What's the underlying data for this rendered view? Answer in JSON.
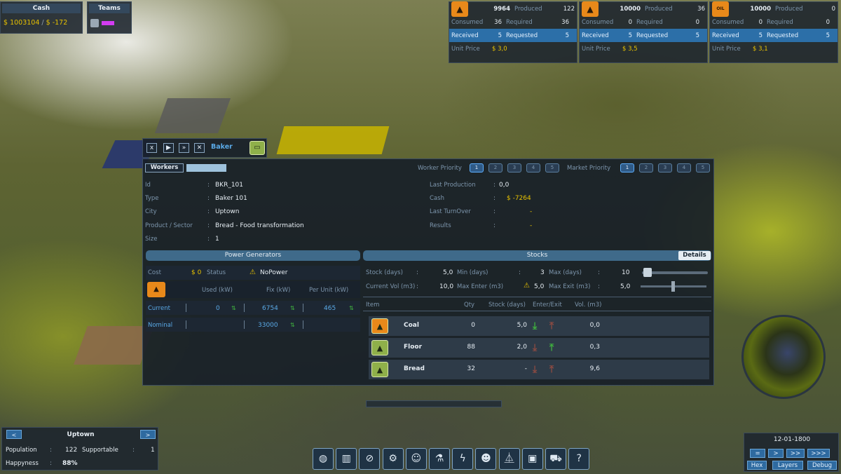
{
  "top_left": {
    "cash_title": "Cash",
    "cash_value": "$ 1003104",
    "cash_sep": "/",
    "cash_delta": "$ -172",
    "teams_title": "Teams"
  },
  "resources": [
    {
      "icon": "coal-icon",
      "icon_bg": "#e8891a",
      "stock": "9964",
      "produced_label": "Produced",
      "produced": "122",
      "consumed_label": "Consumed",
      "consumed": "36",
      "required_label": "Required",
      "required": "36",
      "received_label": "Received",
      "received": "5",
      "requested_label": "Requested",
      "requested": "5",
      "unit_price_label": "Unit Price",
      "unit_price": "$ 3,0"
    },
    {
      "icon": "bread-icon",
      "icon_bg": "#e8891a",
      "stock": "10000",
      "produced_label": "Produced",
      "produced": "36",
      "consumed_label": "Consumed",
      "consumed": "0",
      "required_label": "Required",
      "required": "0",
      "received_label": "Received",
      "received": "5",
      "requested_label": "Requested",
      "requested": "5",
      "unit_price_label": "Unit Price",
      "unit_price": "$ 3,5"
    },
    {
      "icon": "oil-icon",
      "icon_bg": "#e8891a",
      "icon_text": "OIL",
      "stock": "10000",
      "produced_label": "Produced",
      "produced": "0",
      "consumed_label": "Consumed",
      "consumed": "0",
      "required_label": "Required",
      "required": "0",
      "received_label": "Received",
      "received": "5",
      "requested_label": "Requested",
      "requested": "5",
      "unit_price_label": "Unit Price",
      "unit_price": "$ 3,1"
    }
  ],
  "window": {
    "controls": [
      "x",
      "▶",
      "»",
      "✕"
    ],
    "title": "Baker",
    "tab_workers": "Workers",
    "worker_priority_label": "Worker Priority",
    "worker_priority": [
      "1",
      "2",
      "3",
      "4",
      "5"
    ],
    "worker_priority_selected": 1,
    "market_priority_label": "Market Priority",
    "market_priority": [
      "1",
      "2",
      "3",
      "4",
      "5"
    ],
    "market_priority_selected": 1,
    "info": {
      "id_label": "Id",
      "id": "BKR_101",
      "type_label": "Type",
      "type": "Baker 101",
      "city_label": "City",
      "city": "Uptown",
      "sector_label": "Product / Sector",
      "sector": "Bread  -  Food transformation",
      "size_label": "Size",
      "size": "1",
      "last_production_label": "Last Production",
      "last_production": "0,0",
      "cash_label": "Cash",
      "cash": "$ -7264",
      "last_turnover_label": "Last TurnOver",
      "last_turnover": "-",
      "results_label": "Results",
      "results": "-"
    },
    "power": {
      "header": "Power Generators",
      "cost_label": "Cost",
      "cost": "$ 0",
      "status_label": "Status",
      "status": "NoPower",
      "used_label": "Used   (kW)",
      "fix_label": "Fix   (kW)",
      "per_unit_label": "Per Unit   (kW)",
      "current_label": "Current",
      "current_used": "0",
      "current_fix": "6754",
      "current_per_unit": "465",
      "nominal_label": "Nominal",
      "nominal_fix": "33000"
    },
    "stocks": {
      "header": "Stocks",
      "details_button": "Details",
      "stock_days_label": "Stock (days)",
      "stock_days": "5,0",
      "min_days_label": "Min (days)",
      "min_days": "3",
      "max_days_label": "Max (days)",
      "max_days": "10",
      "current_vol_label": "Current Vol (m3)",
      "current_vol": "10,0",
      "max_enter_label": "Max Enter (m3)",
      "max_enter": "5,0",
      "max_exit_label": "Max Exit (m3)",
      "max_exit": "5,0",
      "columns": [
        "Item",
        "Qty",
        "Stock (days)",
        "Enter/Exit",
        "Vol. (m3)"
      ],
      "rows": [
        {
          "icon": "coal-icon",
          "icon_bg": "#e8891a",
          "name": "Coal",
          "qty": "0",
          "stock_days": "5,0",
          "enter": "active",
          "exit": "inactive",
          "vol": "0,0"
        },
        {
          "icon": "flour-icon",
          "icon_bg": "#8fb04a",
          "name": "Floor",
          "qty": "88",
          "stock_days": "2,0",
          "enter": "inactive",
          "exit": "active",
          "vol": "0,3"
        },
        {
          "icon": "bread-icon",
          "icon_bg": "#8fb04a",
          "name": "Bread",
          "qty": "32",
          "stock_days": "-",
          "enter": "inactive",
          "exit": "inactive",
          "vol": "9,6"
        }
      ]
    }
  },
  "city": {
    "prev": "<",
    "name": "Uptown",
    "next": ">",
    "population_label": "Population",
    "population": "122",
    "supportable_label": "Supportable",
    "supportable": "1",
    "happyness_label": "Happyness",
    "happyness": "88%"
  },
  "toolbar": [
    "globe-icon",
    "chart-icon",
    "compass-icon",
    "research-icon",
    "worker-icon",
    "lab-icon",
    "power-icon",
    "population-icon",
    "bridge-icon",
    "crate-icon",
    "wheelbarrow-icon",
    "help-icon"
  ],
  "toolbar_glyphs": [
    "◍",
    "▥",
    "⊘",
    "⚙",
    "☺",
    "⚗",
    "ϟ",
    "☻",
    "⏅",
    "▣",
    "⛟",
    "?"
  ],
  "date": {
    "value": "12-01-1800",
    "speed_buttons": [
      "=",
      ">",
      ">>",
      ">>>"
    ],
    "hex_button": "Hex",
    "layers_button": "Layers",
    "debug_button": "Debug"
  },
  "colors": {
    "accent_yellow": "#e8c200",
    "accent_blue": "#5aa9e6",
    "highlight_row": "#2c6fa8",
    "status_green": "#3fae3f",
    "status_red": "#8a4a42"
  }
}
